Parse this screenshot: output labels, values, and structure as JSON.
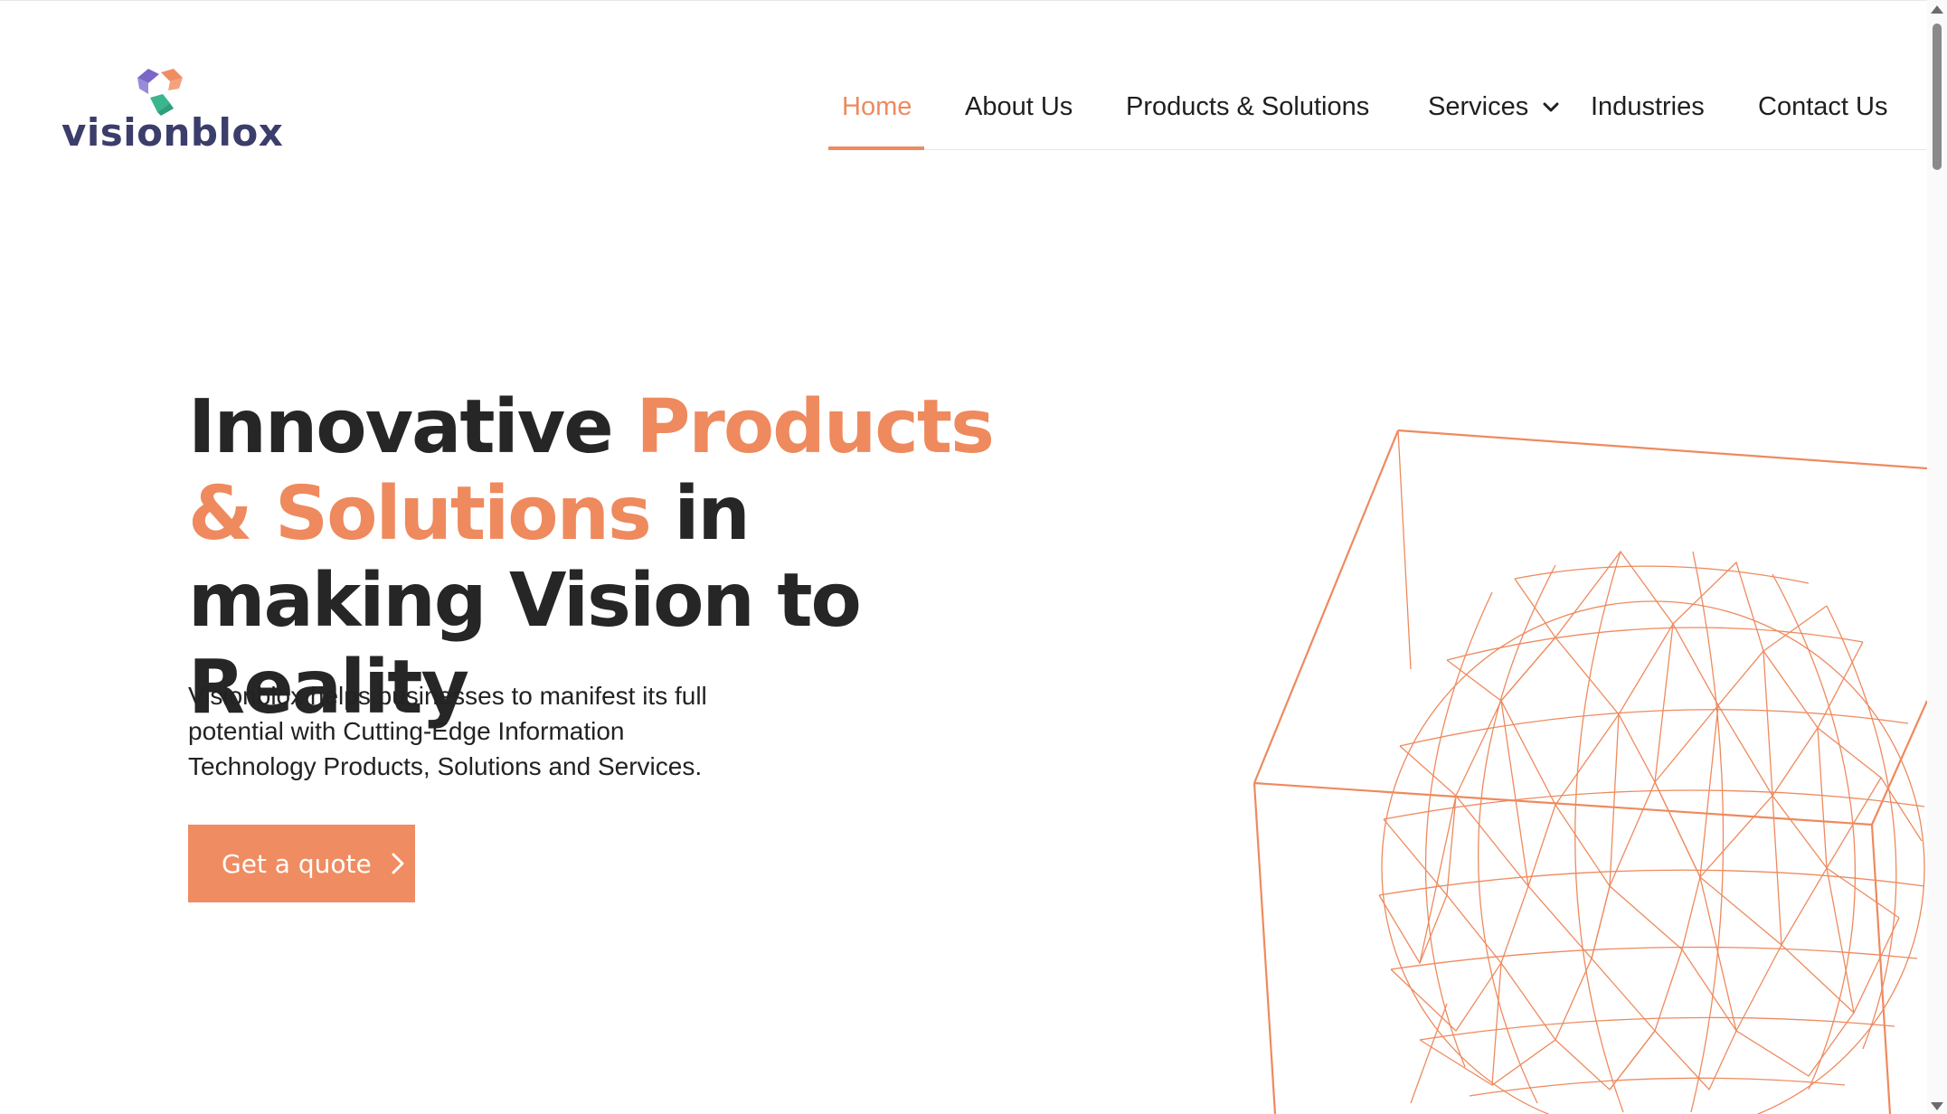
{
  "brand": {
    "name": "visionblox",
    "colors": {
      "purple": "#7b68c6",
      "orange": "#f08c62",
      "green": "#3bb58e",
      "navy": "#3b3d6b"
    }
  },
  "nav": {
    "items": [
      {
        "label": "Home",
        "active": true
      },
      {
        "label": "About Us"
      },
      {
        "label": "Products & Solutions"
      },
      {
        "label": "Services",
        "has_dropdown": true,
        "icon": "chevron-down-icon"
      },
      {
        "label": "Industries"
      },
      {
        "label": "Contact Us"
      }
    ],
    "active_color": "#ee8a5e"
  },
  "hero": {
    "title_part1": "Innovative ",
    "title_accent": "Products & Solutions",
    "title_part2": " in making Vision to Reality",
    "description": "Visionblox helps businesses to manifest its full potential with Cutting-Edge Information Technology Products, Solutions and Services.",
    "cta_label": "Get a quote",
    "cta_icon": "chevron-right-icon"
  },
  "illustration": {
    "icon": "wireframe-sphere-cube-icon",
    "color": "#ee8a5e"
  }
}
